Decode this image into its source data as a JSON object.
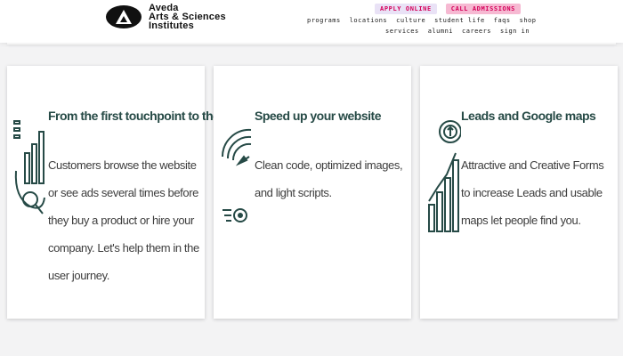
{
  "header": {
    "logo_lines": [
      "Aveda",
      "Arts & Sciences",
      "Institutes"
    ],
    "cta_apply": "APPLY ONLINE",
    "cta_call": "CALL ADMISSIONS",
    "nav_row1": [
      "programs",
      "locations",
      "culture",
      "student life",
      "faqs",
      "shop"
    ],
    "nav_row2": [
      "services",
      "alumni",
      "careers",
      "sign in"
    ]
  },
  "cards": [
    {
      "title": "From the first touchpoint to the sale",
      "description": "Customers browse the website or see ads several times before they buy a product or hire your company. Let's help them in the user journey.",
      "icon": "funnel-chart-icon"
    },
    {
      "title": "Speed up your website",
      "description": "Clean code, optimized images, and light scripts.",
      "icon": "speedometer-icon"
    },
    {
      "title": "Leads and Google maps",
      "description": "Attractive and Creative Forms to increase Leads and usable maps let people find you.",
      "icon": "growth-bars-icon"
    }
  ],
  "colors": {
    "accent_teal": "#264a46",
    "cta_pink": "#d5005a",
    "cta_apply_bg": "#e9e2f6",
    "cta_call_bg": "#f6b9d2"
  }
}
